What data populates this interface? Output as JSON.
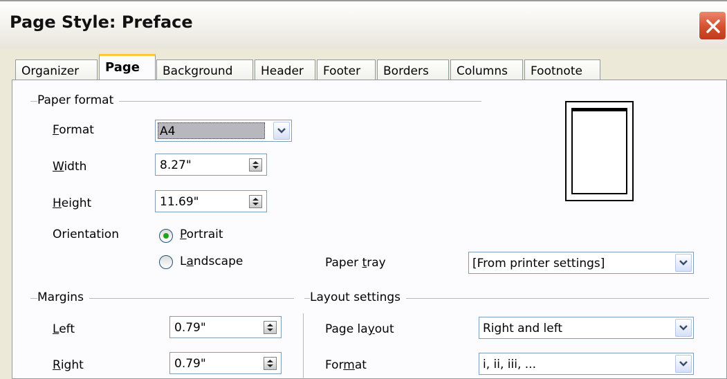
{
  "window": {
    "title": "Page Style: Preface"
  },
  "tabs": [
    "Organizer",
    "Page",
    "Background",
    "Header",
    "Footer",
    "Borders",
    "Columns",
    "Footnote"
  ],
  "active_tab": "Page",
  "paper_format": {
    "section_label": "Paper format",
    "format_label": "Format",
    "format_value": "A4",
    "width_label": "Width",
    "width_value": "8.27\"",
    "height_label": "Height",
    "height_value": "11.69\"",
    "orientation_label": "Orientation",
    "portrait_label": "Portrait",
    "landscape_label": "Landscape",
    "orientation_selected": "Portrait",
    "paper_tray_label": "Paper tray",
    "paper_tray_value": "[From printer settings]"
  },
  "margins": {
    "section_label": "Margins",
    "left_label": "Left",
    "left_value": "0.79\"",
    "right_label": "Right",
    "right_value": "0.79\""
  },
  "layout_settings": {
    "section_label": "Layout settings",
    "page_layout_label": "Page layout",
    "page_layout_value": "Right and left",
    "format_label": "Format",
    "format_value": "i, ii, iii, ..."
  },
  "icons": {
    "close": "close-icon",
    "dropdown": "chevron-down-icon",
    "spin": "spin-updown-icon",
    "page_preview": "page-preview-icon"
  },
  "colors": {
    "close_button": "#d4502e",
    "active_tab_accent": "#ffc83c",
    "radio_dot": "#21a121"
  }
}
